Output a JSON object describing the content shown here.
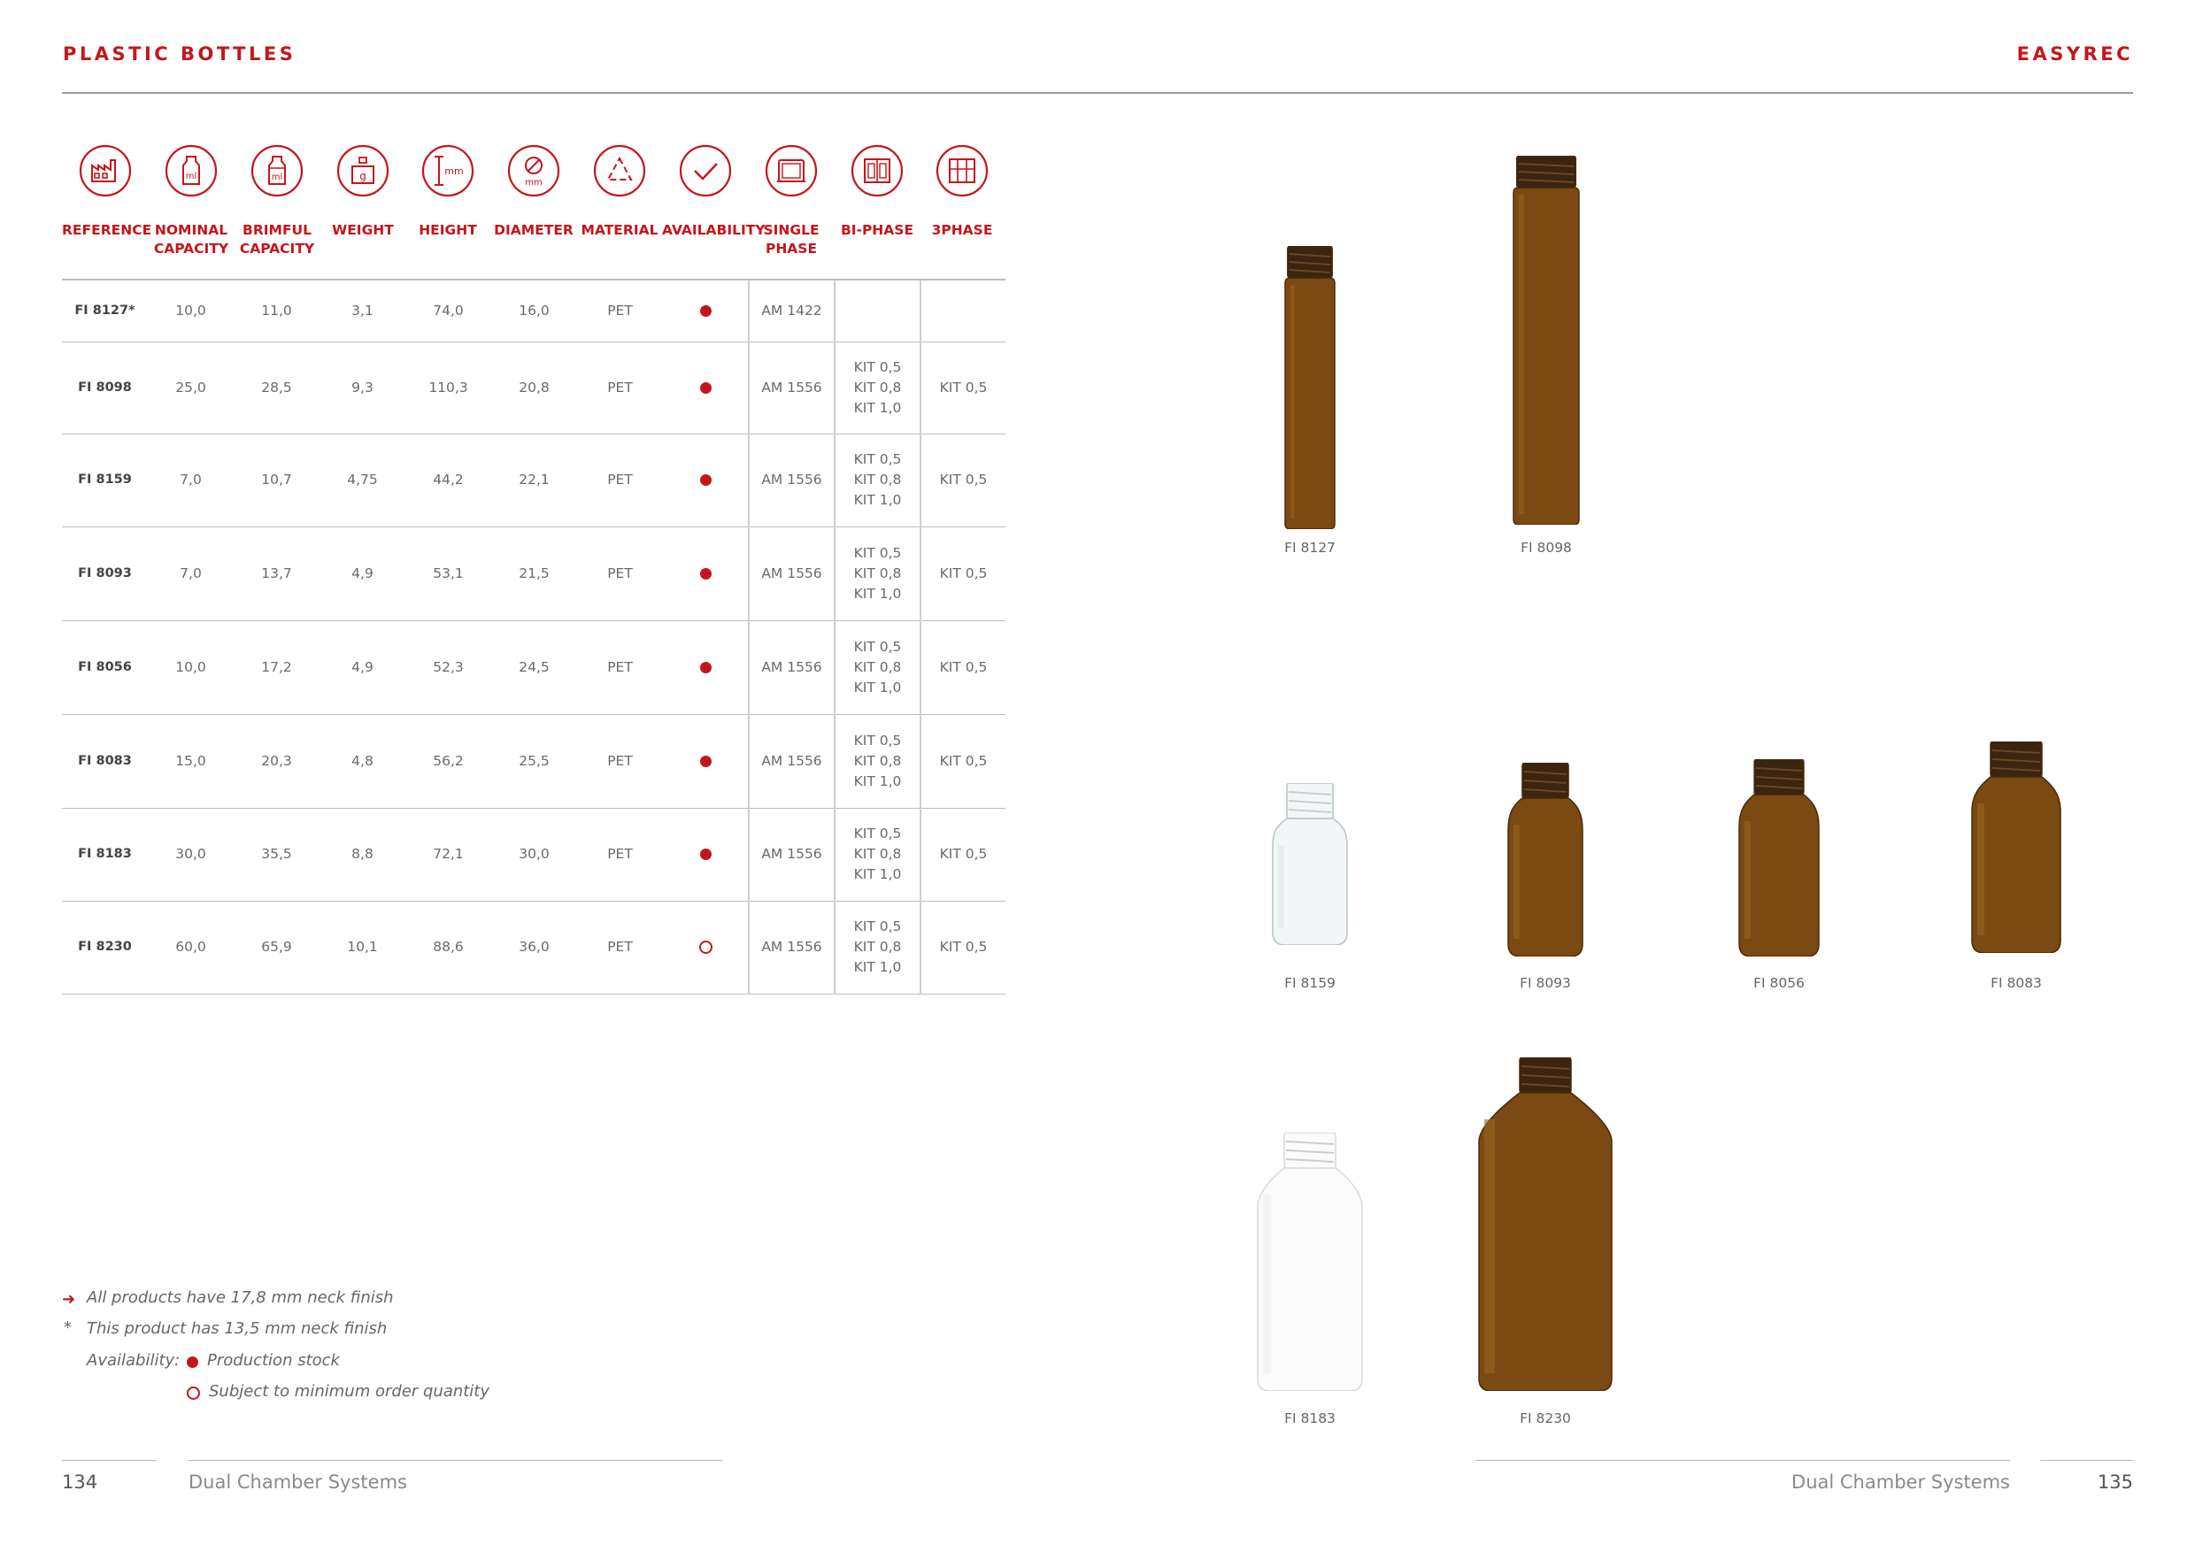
{
  "header": {
    "left_title": "PLASTIC BOTTLES",
    "right_title": "EASYREC"
  },
  "columns": [
    {
      "label": "REFERENCE",
      "icon": "factory-icon"
    },
    {
      "label": "NOMINAL CAPACITY",
      "icon": "bottle-ml-icon"
    },
    {
      "label": "BRIMFUL CAPACITY",
      "icon": "full-bottle-ml-icon"
    },
    {
      "label": "WEIGHT",
      "icon": "weight-g-icon"
    },
    {
      "label": "HEIGHT",
      "icon": "height-mm-icon"
    },
    {
      "label": "DIAMETER",
      "icon": "diameter-mm-icon"
    },
    {
      "label": "MATERIAL",
      "icon": "material-triangle-icon"
    },
    {
      "label": "AVAILABILITY",
      "icon": "checkmark-icon"
    },
    {
      "label": "SINGLE PHASE",
      "icon": "single-phase-icon"
    },
    {
      "label": "BI-PHASE",
      "icon": "bi-phase-icon"
    },
    {
      "label": "3PHASE",
      "icon": "three-phase-icon"
    }
  ],
  "rows": [
    {
      "ref": "FI 8127*",
      "nominal": "10,0",
      "brimful": "11,0",
      "weight": "3,1",
      "height": "74,0",
      "diameter": "16,0",
      "material": "PET",
      "availability": "stock",
      "single": "AM 1422",
      "bi": [],
      "three": ""
    },
    {
      "ref": "FI 8098",
      "nominal": "25,0",
      "brimful": "28,5",
      "weight": "9,3",
      "height": "110,3",
      "diameter": "20,8",
      "material": "PET",
      "availability": "stock",
      "single": "AM 1556",
      "bi": [
        "KIT 0,5",
        "KIT 0,8",
        "KIT 1,0"
      ],
      "three": "KIT 0,5"
    },
    {
      "ref": "FI 8159",
      "nominal": "7,0",
      "brimful": "10,7",
      "weight": "4,75",
      "height": "44,2",
      "diameter": "22,1",
      "material": "PET",
      "availability": "stock",
      "single": "AM 1556",
      "bi": [
        "KIT 0,5",
        "KIT 0,8",
        "KIT 1,0"
      ],
      "three": "KIT 0,5"
    },
    {
      "ref": "FI 8093",
      "nominal": "7,0",
      "brimful": "13,7",
      "weight": "4,9",
      "height": "53,1",
      "diameter": "21,5",
      "material": "PET",
      "availability": "stock",
      "single": "AM 1556",
      "bi": [
        "KIT 0,5",
        "KIT 0,8",
        "KIT 1,0"
      ],
      "three": "KIT 0,5"
    },
    {
      "ref": "FI 8056",
      "nominal": "10,0",
      "brimful": "17,2",
      "weight": "4,9",
      "height": "52,3",
      "diameter": "24,5",
      "material": "PET",
      "availability": "stock",
      "single": "AM 1556",
      "bi": [
        "KIT 0,5",
        "KIT 0,8",
        "KIT 1,0"
      ],
      "three": "KIT 0,5"
    },
    {
      "ref": "FI 8083",
      "nominal": "15,0",
      "brimful": "20,3",
      "weight": "4,8",
      "height": "56,2",
      "diameter": "25,5",
      "material": "PET",
      "availability": "stock",
      "single": "AM 1556",
      "bi": [
        "KIT 0,5",
        "KIT 0,8",
        "KIT 1,0"
      ],
      "three": "KIT 0,5"
    },
    {
      "ref": "FI 8183",
      "nominal": "30,0",
      "brimful": "35,5",
      "weight": "8,8",
      "height": "72,1",
      "diameter": "30,0",
      "material": "PET",
      "availability": "stock",
      "single": "AM 1556",
      "bi": [
        "KIT 0,5",
        "KIT 0,8",
        "KIT 1,0"
      ],
      "three": "KIT 0,5"
    },
    {
      "ref": "FI 8230",
      "nominal": "60,0",
      "brimful": "65,9",
      "weight": "10,1",
      "height": "88,6",
      "diameter": "36,0",
      "material": "PET",
      "availability": "moq",
      "single": "AM 1556",
      "bi": [
        "KIT 0,5",
        "KIT 0,8",
        "KIT 1,0"
      ],
      "three": "KIT 0,5"
    }
  ],
  "notes": {
    "neck_finish": "All products have 17,8 mm neck finish",
    "asterisk_mark": "*",
    "asterisk": "This product has 13,5 mm neck finish",
    "availability_label": "Availability:",
    "stock": "Production stock",
    "moq": "Subject to minimum order quantity"
  },
  "bottles": [
    {
      "caption": "FI 8127",
      "color": "#7a4a12",
      "kind": "tube"
    },
    {
      "caption": "FI 8098",
      "color": "#7a4a12",
      "kind": "tube"
    },
    {
      "caption": "FI 8159",
      "color": "clear",
      "kind": "round"
    },
    {
      "caption": "FI 8093",
      "color": "#7a4a12",
      "kind": "round"
    },
    {
      "caption": "FI 8056",
      "color": "#7a4a12",
      "kind": "round"
    },
    {
      "caption": "FI 8083",
      "color": "#7a4a12",
      "kind": "round"
    },
    {
      "caption": "FI 8183",
      "color": "#ffffff",
      "kind": "round"
    },
    {
      "caption": "FI 8230",
      "color": "#7a4a12",
      "kind": "round"
    }
  ],
  "footer": {
    "left_page": "134",
    "left_text": "Dual Chamber Systems",
    "right_text": "Dual Chamber Systems",
    "right_page": "135"
  },
  "colors": {
    "accent": "#c4161c",
    "amber": "#7a4a12"
  }
}
